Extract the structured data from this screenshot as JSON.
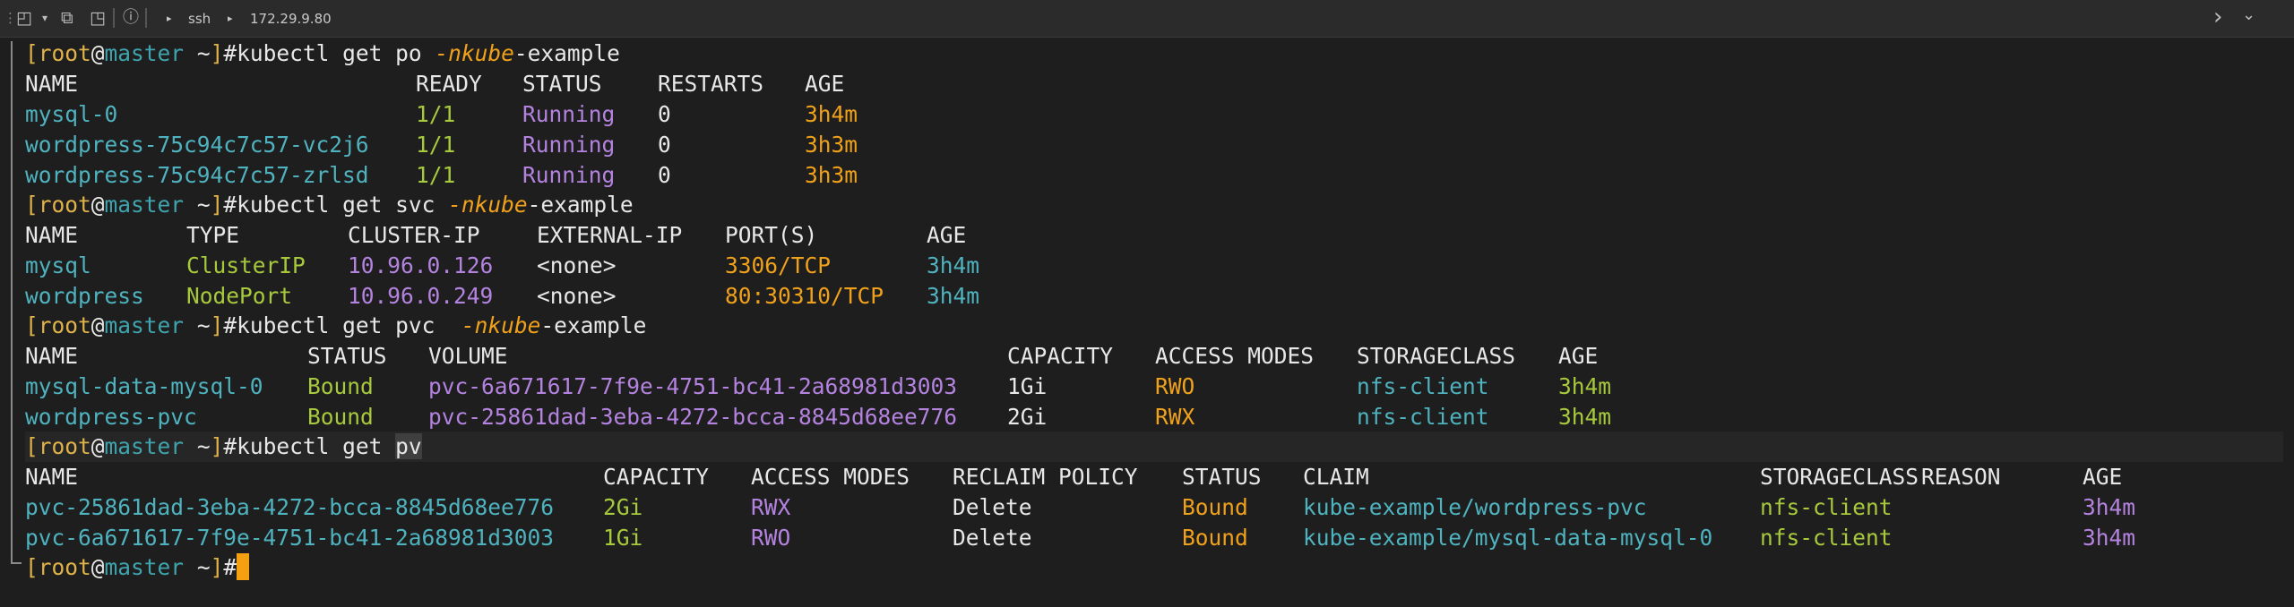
{
  "tabbar": {
    "info_glyph": "ⓘ",
    "arrow1": "▸",
    "protocol": "ssh",
    "arrow2": "▸",
    "host_ip": "172.29.9.80",
    "chevron_right": "›",
    "chevron_down": "⌄"
  },
  "prompt": {
    "open": "[",
    "user": "root",
    "at": "@",
    "host": "master",
    "tilde": " ~",
    "close": "]",
    "hash": "#"
  },
  "commands": {
    "c1": {
      "base": "kubectl get po ",
      "flag": "-nkube",
      "rest": "-example"
    },
    "c2": {
      "base": "kubectl get svc ",
      "flag": "-nkube",
      "rest": "-example"
    },
    "c3": {
      "base": "kubectl get pvc  ",
      "flag": "-nkube",
      "rest": "-example"
    },
    "c4": {
      "base": "kubectl get ",
      "selected": "pv"
    }
  },
  "pods": {
    "headers": [
      "NAME",
      "READY",
      "STATUS",
      "RESTARTS",
      "AGE"
    ],
    "rows": [
      [
        "mysql-0",
        "1/1",
        "Running",
        "0",
        "3h4m"
      ],
      [
        "wordpress-75c94c7c57-vc2j6",
        "1/1",
        "Running",
        "0",
        "3h3m"
      ],
      [
        "wordpress-75c94c7c57-zrlsd",
        "1/1",
        "Running",
        "0",
        "3h3m"
      ]
    ]
  },
  "svc": {
    "headers": [
      "NAME",
      "TYPE",
      "CLUSTER-IP",
      "EXTERNAL-IP",
      "PORT(S)",
      "AGE"
    ],
    "rows": [
      [
        "mysql",
        "ClusterIP",
        "10.96.0.126",
        "<none>",
        "3306/TCP",
        "3h4m"
      ],
      [
        "wordpress",
        "NodePort",
        "10.96.0.249",
        "<none>",
        "80:30310/TCP",
        "3h4m"
      ]
    ]
  },
  "pvc": {
    "headers": [
      "NAME",
      "STATUS",
      "VOLUME",
      "CAPACITY",
      "ACCESS MODES",
      "STORAGECLASS",
      "AGE"
    ],
    "rows": [
      [
        "mysql-data-mysql-0",
        "Bound",
        "pvc-6a671617-7f9e-4751-bc41-2a68981d3003",
        "1Gi",
        "RWO",
        "nfs-client",
        "3h4m"
      ],
      [
        "wordpress-pvc",
        "Bound",
        "pvc-25861dad-3eba-4272-bcca-8845d68ee776",
        "2Gi",
        "RWX",
        "nfs-client",
        "3h4m"
      ]
    ]
  },
  "pv": {
    "headers": [
      "NAME",
      "CAPACITY",
      "ACCESS MODES",
      "RECLAIM POLICY",
      "STATUS",
      "CLAIM",
      "STORAGECLASS",
      "REASON",
      "AGE"
    ],
    "rows": [
      [
        "pvc-25861dad-3eba-4272-bcca-8845d68ee776",
        "2Gi",
        "RWX",
        "Delete",
        "Bound",
        "kube-example/wordpress-pvc",
        "nfs-client",
        "",
        "3h4m"
      ],
      [
        "pvc-6a671617-7f9e-4751-bc41-2a68981d3003",
        "1Gi",
        "RWO",
        "Delete",
        "Bound",
        "kube-example/mysql-data-mysql-0",
        "nfs-client",
        "",
        "3h4m"
      ]
    ]
  },
  "colors": {
    "background": "#1e1e1e",
    "prompt_user": "#e0b24a",
    "prompt_host": "#3fa4ad",
    "flag": "#f0a11b",
    "teal": "#4fb3bf",
    "green": "#a7c93c",
    "purple": "#b483e0",
    "cursor": "#f4a010"
  }
}
